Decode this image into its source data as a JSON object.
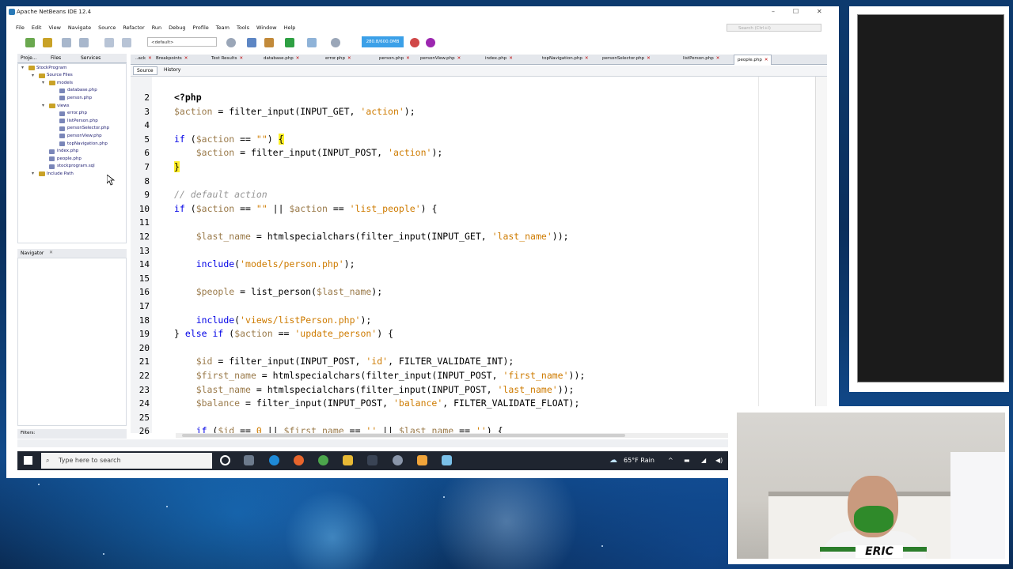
{
  "window": {
    "title": "Apache NetBeans IDE 12.4",
    "controls": [
      "–",
      "☐",
      "✕"
    ]
  },
  "menu": [
    "File",
    "Edit",
    "View",
    "Navigate",
    "Source",
    "Refactor",
    "Run",
    "Debug",
    "Profile",
    "Team",
    "Tools",
    "Window",
    "Help"
  ],
  "search": {
    "placeholder": "Search (Ctrl+I)"
  },
  "toolbar": {
    "config": "<default>",
    "memory": "280.8/600.0MB"
  },
  "left_tabs": [
    "Proje...",
    "Files",
    "Services"
  ],
  "tree": [
    {
      "label": "StockProgram",
      "depth": 0,
      "kind": "project"
    },
    {
      "label": "Source Files",
      "depth": 1,
      "kind": "folder"
    },
    {
      "label": "models",
      "depth": 2,
      "kind": "folder"
    },
    {
      "label": "database.php",
      "depth": 3,
      "kind": "php"
    },
    {
      "label": "person.php",
      "depth": 3,
      "kind": "php"
    },
    {
      "label": "views",
      "depth": 2,
      "kind": "folder"
    },
    {
      "label": "error.php",
      "depth": 3,
      "kind": "php"
    },
    {
      "label": "listPerson.php",
      "depth": 3,
      "kind": "php"
    },
    {
      "label": "personSelector.php",
      "depth": 3,
      "kind": "php"
    },
    {
      "label": "personView.php",
      "depth": 3,
      "kind": "php"
    },
    {
      "label": "topNavigation.php",
      "depth": 3,
      "kind": "php"
    },
    {
      "label": "index.php",
      "depth": 2,
      "kind": "php"
    },
    {
      "label": "people.php",
      "depth": 2,
      "kind": "php"
    },
    {
      "label": "stockprogram.sql",
      "depth": 2,
      "kind": "php"
    },
    {
      "label": "Include Path",
      "depth": 1,
      "kind": "folder"
    }
  ],
  "navigator": {
    "title": "Navigator"
  },
  "filters": {
    "label": "Filters:"
  },
  "editor_tabs": [
    {
      "label": "..ack"
    },
    {
      "label": "Breakpoints"
    },
    {
      "label": "Test Results"
    },
    {
      "label": "database.php"
    },
    {
      "label": "error.php"
    },
    {
      "label": "person.php"
    },
    {
      "label": "personView.php"
    },
    {
      "label": "index.php"
    },
    {
      "label": "topNavigation.php"
    },
    {
      "label": "personSelector.php"
    },
    {
      "label": "listPerson.php"
    },
    {
      "label": "people.php"
    }
  ],
  "editor_toolbar": {
    "source": "Source",
    "history": "History"
  },
  "code": {
    "line_numbers": [
      "2",
      "3",
      "4",
      "5",
      "6",
      "7",
      "8",
      "9",
      "10",
      "11",
      "12",
      "13",
      "14",
      "15",
      "16",
      "17",
      "18",
      "19",
      "20",
      "21",
      "22",
      "23",
      "24",
      "25",
      "26"
    ]
  },
  "taskbar": {
    "search_placeholder": "Type here to search",
    "weather": "65°F Rain"
  },
  "webcam": {
    "name": "ERIC"
  },
  "colors": {
    "keyword": "#0000e6",
    "variable": "#9a7a4a",
    "string": "#ce7b00",
    "comment": "#969696",
    "memory_bar": "#3ba0e8"
  }
}
